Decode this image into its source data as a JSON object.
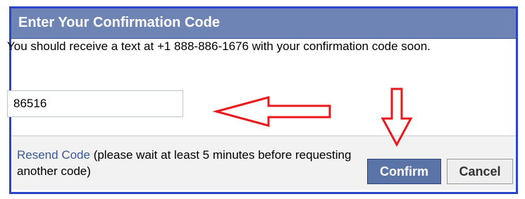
{
  "dialog": {
    "title": "Enter Your Confirmation Code",
    "message": "You should receive a text at +1 888-886-1676 with your confirmation code soon.",
    "code_input": {
      "value": "86516",
      "placeholder": ""
    },
    "footer": {
      "resend_link_label": "Resend Code",
      "resend_note": " (please wait at least 5 minutes before requesting another code)"
    },
    "buttons": {
      "confirm_label": "Confirm",
      "cancel_label": "Cancel"
    }
  },
  "annotations": {
    "arrow_color": "#e8191f",
    "arrows": [
      "left-arrow",
      "down-arrow"
    ]
  },
  "colors": {
    "header_bg": "#6d84b4",
    "link": "#3b5998",
    "confirm_bg": "#5b74a8",
    "border": "#2b47c8"
  }
}
